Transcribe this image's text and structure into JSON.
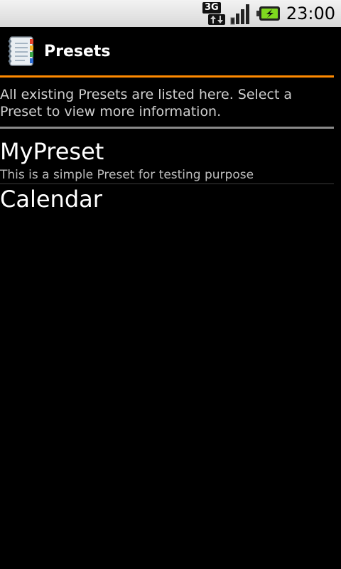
{
  "status_bar": {
    "network_type": "3G",
    "time": "23:00"
  },
  "icons": {
    "network": "3g-data-icon",
    "signal": "signal-strength-icon",
    "battery": "battery-charging-icon",
    "app": "notebook-app-icon"
  },
  "colors": {
    "accent": "#ff8a00",
    "background": "#000000",
    "primary_text": "#ffffff",
    "secondary_text": "#cfcfcf"
  },
  "header": {
    "title": "Presets"
  },
  "main": {
    "description": "All existing Presets are listed here. Select a Preset to view more information.",
    "presets": [
      {
        "title": "MyPreset",
        "subtitle": "This is a simple Preset for testing purpose"
      },
      {
        "title": "Calendar",
        "subtitle": ""
      }
    ]
  }
}
